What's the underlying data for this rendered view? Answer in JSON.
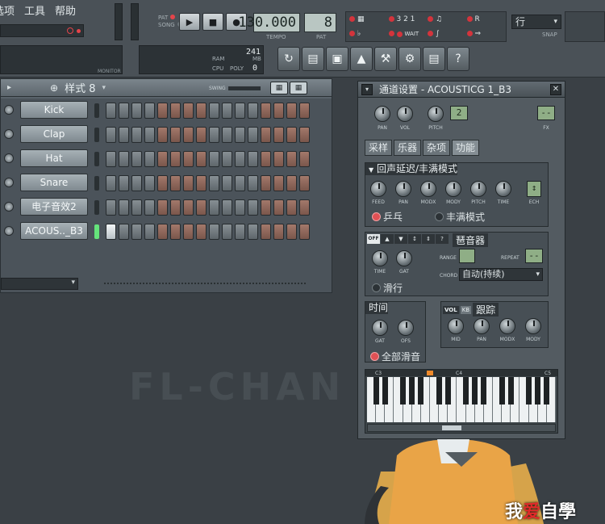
{
  "menu": {
    "items": [
      "选项",
      "工具",
      "帮助"
    ]
  },
  "transport": {
    "pat_label": "PAT",
    "song_label": "SONG",
    "tempo": "130.000",
    "tempo_label": "TEMPO",
    "pattern": "8",
    "pattern_label": "PAT"
  },
  "modes": {
    "snap_value": "行",
    "snap_label": "SNAP",
    "wait_label": "WAIT"
  },
  "monitor": {
    "label": "MONITOR",
    "ram_label": "RAM",
    "cpu_label": "CPU",
    "poly_label": "POLY",
    "ram_value": "241",
    "mb_label": "MB",
    "poly_value": "0"
  },
  "sequencer": {
    "pattern_name": "样式 8",
    "swing_label": "SWING",
    "channels": [
      {
        "name": "Kick",
        "selected": false,
        "steps": [
          0,
          0,
          0,
          0,
          0,
          0,
          0,
          0,
          0,
          0,
          0,
          0,
          0,
          0,
          0,
          0
        ]
      },
      {
        "name": "Clap",
        "selected": false,
        "steps": [
          0,
          0,
          0,
          0,
          0,
          0,
          0,
          0,
          0,
          0,
          0,
          0,
          0,
          0,
          0,
          0
        ]
      },
      {
        "name": "Hat",
        "selected": false,
        "steps": [
          0,
          0,
          0,
          0,
          0,
          0,
          0,
          0,
          0,
          0,
          0,
          0,
          0,
          0,
          0,
          0
        ]
      },
      {
        "name": "Snare",
        "selected": false,
        "steps": [
          0,
          0,
          0,
          0,
          0,
          0,
          0,
          0,
          0,
          0,
          0,
          0,
          0,
          0,
          0,
          0
        ]
      },
      {
        "name": "电子音效2",
        "selected": false,
        "steps": [
          0,
          0,
          0,
          0,
          0,
          0,
          0,
          0,
          0,
          0,
          0,
          0,
          0,
          0,
          0,
          0
        ]
      },
      {
        "name": "ACOUS.._B3",
        "selected": true,
        "steps": [
          1,
          0,
          0,
          0,
          0,
          0,
          0,
          0,
          0,
          0,
          0,
          0,
          0,
          0,
          0,
          0
        ]
      }
    ]
  },
  "channel_settings": {
    "title": "通道设置 - ACOUSTICG 1_B3",
    "top_knobs": [
      "PAN",
      "VOL",
      "PITCH"
    ],
    "pitch_value": "2",
    "fx_label": "FX",
    "fx_value": "--",
    "tabs": [
      "采样",
      "乐器",
      "杂项",
      "功能"
    ],
    "echo": {
      "title": "回声延迟/丰满模式",
      "knobs": [
        "FEED",
        "PAN",
        "MODX",
        "MODY",
        "PITCH",
        "TIME",
        "ECH"
      ],
      "radio_pingpong": "乒乓",
      "radio_fat": "丰满模式"
    },
    "arp": {
      "title": "琶音器",
      "off_label": "OFF",
      "knobs": [
        "TIME",
        "GAT"
      ],
      "range_label": "RANGE",
      "repeat_label": "REPEAT",
      "repeat_value": "--",
      "chord_label": "CHORD",
      "chord_value": "自动(持续)",
      "slide_label": "滑行"
    },
    "time": {
      "title": "时间",
      "knobs": [
        "GAT",
        "OFS"
      ],
      "mute_all": "全部滑音"
    },
    "track": {
      "vol_label": "VOL",
      "kb_label": "KB",
      "title": "跟踪",
      "knobs": [
        "MID",
        "PAN",
        "MODX",
        "MODY"
      ]
    },
    "piano": {
      "marks": [
        "C3",
        "C4",
        "C5"
      ]
    }
  },
  "background": {
    "watermark": "FL-CHAN"
  },
  "credit": {
    "prefix": "我",
    "heart": "爱",
    "suffix": "自學"
  }
}
